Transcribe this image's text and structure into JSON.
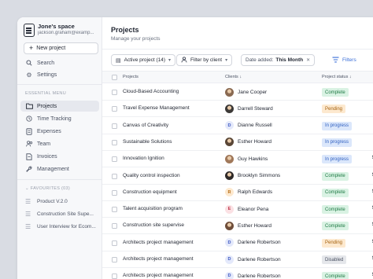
{
  "sidebar": {
    "space_name": "Jone's space",
    "space_email": "jackson.graham@examp...",
    "new_project_label": "New project",
    "top_items": [
      {
        "label": "Search",
        "icon": "search-icon"
      },
      {
        "label": "Settings",
        "icon": "gear-icon"
      }
    ],
    "menu_label": "ESSENTIAL MENU",
    "menu_items": [
      {
        "label": "Projects",
        "icon": "folder-icon",
        "active": true
      },
      {
        "label": "Time Tracking",
        "icon": "clock-icon",
        "active": false
      },
      {
        "label": "Expenses",
        "icon": "receipt-icon",
        "active": false
      },
      {
        "label": "Team",
        "icon": "team-icon",
        "active": false
      },
      {
        "label": "Invoices",
        "icon": "invoice-icon",
        "active": false
      },
      {
        "label": "Management",
        "icon": "wrench-icon",
        "active": false
      }
    ],
    "favourites_label": "FAVOURITES (03)",
    "favourites": [
      {
        "label": "Product V.2.0"
      },
      {
        "label": "Construction Site Supe..."
      },
      {
        "label": "User Interview for Ecom..."
      }
    ]
  },
  "main": {
    "title": "Projects",
    "subtitle": "Manage your projects",
    "filters": {
      "active_project": "Active project (14)",
      "filter_by_client": "Filter by client",
      "date_added_prefix": "Date added:",
      "date_added_value": "This Month",
      "filters_label": "Filters"
    },
    "columns": {
      "projects": "Projects",
      "clients": "Clients",
      "status": "Project status"
    },
    "rows": [
      {
        "project": "Cloud-Based Accounting",
        "client": "Jane Cooper",
        "avatar": "photo",
        "status": "Complete",
        "dollar": ""
      },
      {
        "project": "Travel Expense Management",
        "client": "Darrell Steward",
        "avatar": "photo",
        "status": "Pending",
        "dollar": ""
      },
      {
        "project": "Canvas of Creativity",
        "client": "Dianne Russell",
        "avatar": "D",
        "status": "In progress",
        "dollar": ""
      },
      {
        "project": "Sustainable Solutions",
        "client": "Esther Howard",
        "avatar": "photo",
        "status": "In progress",
        "dollar": ""
      },
      {
        "project": "Innovation Ignition",
        "client": "Guy Hawkins",
        "avatar": "photo",
        "status": "In progress",
        "dollar": "$"
      },
      {
        "project": "Quality control inspection",
        "client": "Brooklyn Simmons",
        "avatar": "photo",
        "status": "Complete",
        "dollar": "$"
      },
      {
        "project": "Construction equipment",
        "client": "Ralph Edwards",
        "avatar": "R",
        "status": "Complete",
        "dollar": "$"
      },
      {
        "project": "Talent acquisition program",
        "client": "Eleanor Pena",
        "avatar": "E",
        "status": "Complete",
        "dollar": "$"
      },
      {
        "project": "Construction site supervise",
        "client": "Esther Howard",
        "avatar": "photo",
        "status": "Complete",
        "dollar": "$"
      },
      {
        "project": "Architects project management",
        "client": "Darlene Robertson",
        "avatar": "D",
        "status": "Pending",
        "dollar": "$"
      },
      {
        "project": "Architects project management",
        "client": "Darlene Robertson",
        "avatar": "D",
        "status": "Disabled",
        "dollar": "$"
      },
      {
        "project": "Architects project management",
        "client": "Darlene Robertson",
        "avatar": "D",
        "status": "Complete",
        "dollar": "$"
      }
    ]
  },
  "colors": {
    "complete_bg": "#d9f2e3",
    "complete_fg": "#1f7a45",
    "pending_bg": "#fde9cf",
    "pending_fg": "#a5620f",
    "progress_bg": "#dbe7fb",
    "progress_fg": "#2f5fc0",
    "disabled_bg": "#e5e7eb",
    "disabled_fg": "#4b5263",
    "accent": "#3b6fd8"
  }
}
